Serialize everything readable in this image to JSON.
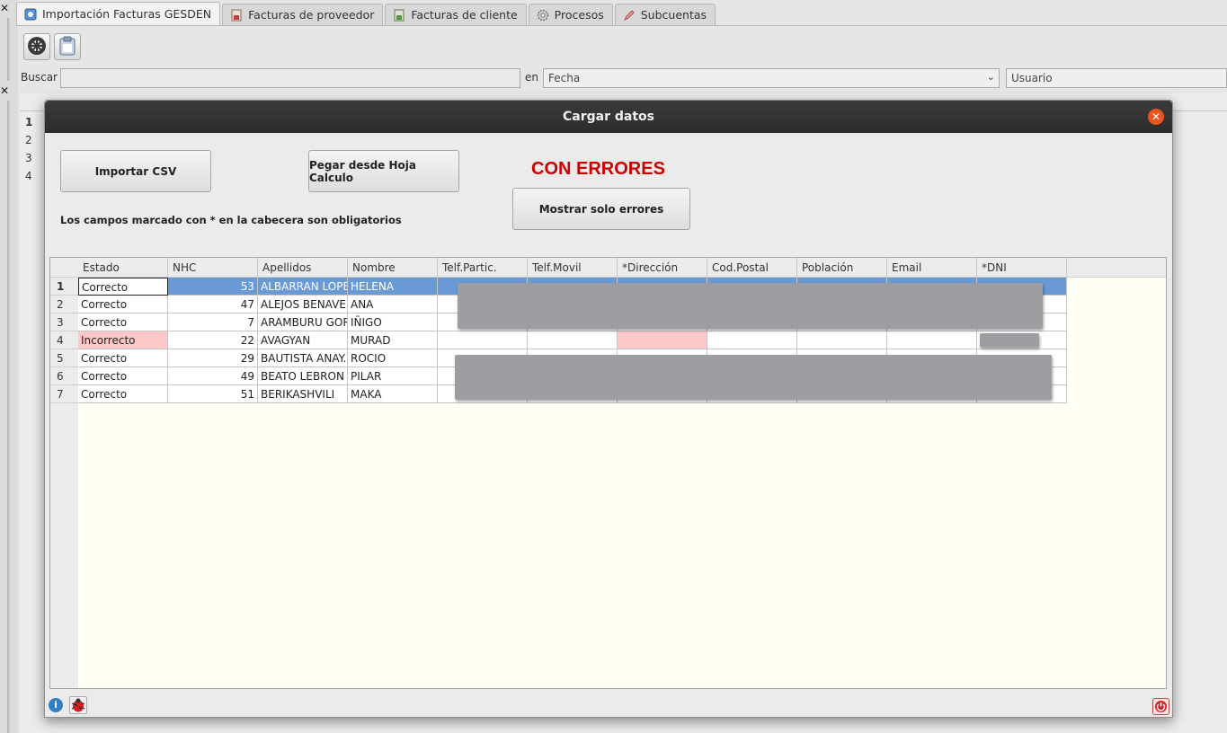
{
  "tabs": [
    {
      "label": "Importación Facturas GESDEN",
      "active": true
    },
    {
      "label": "Facturas de proveedor",
      "active": false
    },
    {
      "label": "Facturas de cliente",
      "active": false
    },
    {
      "label": "Procesos",
      "active": false
    },
    {
      "label": "Subcuentas",
      "active": false
    }
  ],
  "search": {
    "label": "Buscar",
    "value": "",
    "in_label": "en",
    "field_value": "Fecha",
    "user_value": "Usuario"
  },
  "background_rows": [
    "1",
    "2",
    "3",
    "4"
  ],
  "dialog": {
    "title": "Cargar datos",
    "import_csv_label": "Importar CSV",
    "paste_label": "Pegar desde Hoja Calculo",
    "status_label": "CON ERRORES",
    "show_errors_label": "Mostrar solo errores",
    "note": "Los campos marcado con * en la cabecera son obligatorios"
  },
  "grid": {
    "columns": [
      "Estado",
      "NHC",
      "Apellidos",
      "Nombre",
      "Telf.Partic.",
      "Telf.Movil",
      "*Dirección",
      "Cod.Postal",
      "Población",
      "Email",
      "*DNI"
    ],
    "rows": [
      {
        "num": "1",
        "estado": "Correcto",
        "nhc": "53",
        "apellidos": "ALBARRAN LOPE",
        "nombre": "HELENA",
        "selected": true,
        "error": false
      },
      {
        "num": "2",
        "estado": "Correcto",
        "nhc": "47",
        "apellidos": "ALEJOS BENAVEI",
        "nombre": "ANA",
        "selected": false,
        "error": false
      },
      {
        "num": "3",
        "estado": "Correcto",
        "nhc": "7",
        "apellidos": "ARAMBURU GOR",
        "nombre": "IÑIGO",
        "selected": false,
        "error": false
      },
      {
        "num": "4",
        "estado": "Incorrecto",
        "nhc": "22",
        "apellidos": "AVAGYAN",
        "nombre": "MURAD",
        "selected": false,
        "error": true
      },
      {
        "num": "5",
        "estado": "Correcto",
        "nhc": "29",
        "apellidos": "BAUTISTA ANAY.",
        "nombre": "ROCIO",
        "selected": false,
        "error": false
      },
      {
        "num": "6",
        "estado": "Correcto",
        "nhc": "49",
        "apellidos": "BEATO LEBRON",
        "nombre": "PILAR",
        "selected": false,
        "error": false
      },
      {
        "num": "7",
        "estado": "Correcto",
        "nhc": "51",
        "apellidos": "BERIKASHVILI",
        "nombre": "MAKA",
        "selected": false,
        "error": false
      }
    ]
  },
  "colors": {
    "error_text": "#cc0000",
    "error_cell": "#ffc8c8",
    "selection": "#6a9ad6",
    "title_bar": "#2c2c2c",
    "close_button": "#e9541f"
  },
  "icons": {
    "info": "info-icon",
    "debug": "bug-icon",
    "power": "power-icon",
    "close": "close-icon"
  }
}
